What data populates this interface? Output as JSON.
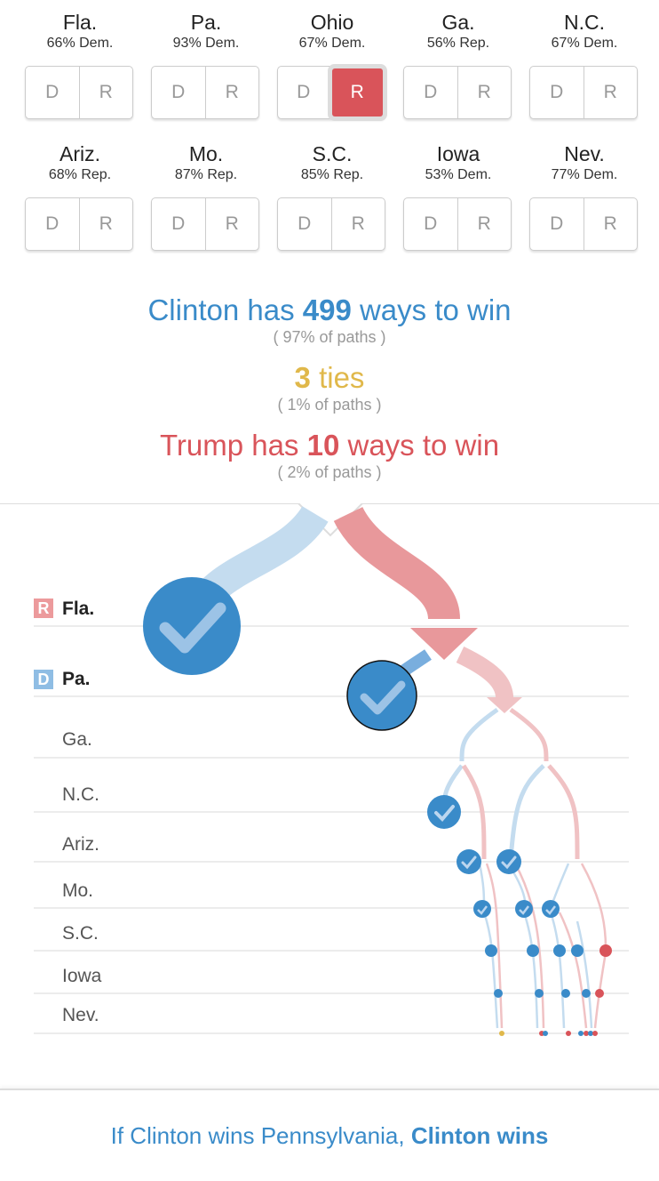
{
  "states": [
    {
      "name": "Fla.",
      "pct": "66% Dem.",
      "d": "D",
      "r": "R",
      "selected": "none"
    },
    {
      "name": "Pa.",
      "pct": "93% Dem.",
      "d": "D",
      "r": "R",
      "selected": "none"
    },
    {
      "name": "Ohio",
      "pct": "67% Dem.",
      "d": "D",
      "r": "R",
      "selected": "R"
    },
    {
      "name": "Ga.",
      "pct": "56% Rep.",
      "d": "D",
      "r": "R",
      "selected": "none"
    },
    {
      "name": "N.C.",
      "pct": "67% Dem.",
      "d": "D",
      "r": "R",
      "selected": "none"
    },
    {
      "name": "Ariz.",
      "pct": "68% Rep.",
      "d": "D",
      "r": "R",
      "selected": "none"
    },
    {
      "name": "Mo.",
      "pct": "87% Rep.",
      "d": "D",
      "r": "R",
      "selected": "none"
    },
    {
      "name": "S.C.",
      "pct": "85% Rep.",
      "d": "D",
      "r": "R",
      "selected": "none"
    },
    {
      "name": "Iowa",
      "pct": "53% Dem.",
      "d": "D",
      "r": "R",
      "selected": "none"
    },
    {
      "name": "Nev.",
      "pct": "77% Dem.",
      "d": "D",
      "r": "R",
      "selected": "none"
    }
  ],
  "summary": {
    "clinton_pre": "Clinton has ",
    "clinton_num": "499",
    "clinton_post": " ways to win",
    "clinton_pct": "( 97% of paths )",
    "ties_num": "3",
    "ties_post": " ties",
    "ties_pct": "( 1% of paths )",
    "trump_pre": "Trump has ",
    "trump_num": "10",
    "trump_post": " ways to win",
    "trump_pct": "( 2% of paths )"
  },
  "tree_rows": [
    {
      "badge": "R",
      "label": "Fla.",
      "bold": true
    },
    {
      "badge": "D",
      "label": "Pa.",
      "bold": true
    },
    {
      "badge": "",
      "label": "Ga.",
      "bold": false
    },
    {
      "badge": "",
      "label": "N.C.",
      "bold": false
    },
    {
      "badge": "",
      "label": "Ariz.",
      "bold": false
    },
    {
      "badge": "",
      "label": "Mo.",
      "bold": false
    },
    {
      "badge": "",
      "label": "S.C.",
      "bold": false
    },
    {
      "badge": "",
      "label": "Iowa",
      "bold": false
    },
    {
      "badge": "",
      "label": "Nev.",
      "bold": false
    }
  ],
  "footer": {
    "pre": "If Clinton wins Pennsylvania, ",
    "post": "Clinton wins"
  },
  "colors": {
    "dem": "#3a8bc9",
    "rep": "#d9545a",
    "dem_light": "#c4dcef",
    "rep_light": "#f0c2c4",
    "tie": "#e0b84a"
  }
}
